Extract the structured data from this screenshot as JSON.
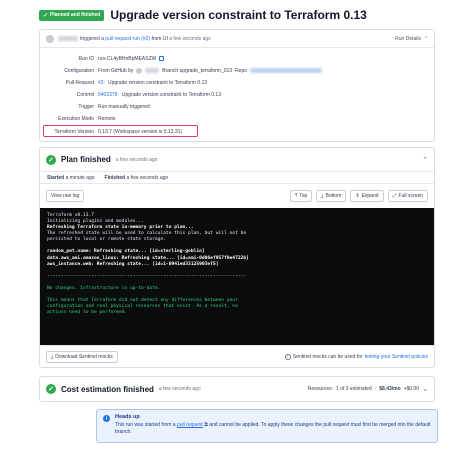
{
  "header": {
    "badge": "Planned and finished",
    "title": "Upgrade version constraint to Terraform 0.13"
  },
  "run": {
    "triggered_text": "triggered a",
    "pr_link": "pull request run (#2)",
    "from_text": "from UI",
    "ago": "a few seconds ago",
    "details_label": "Run Details",
    "fields": {
      "run_id_label": "Run ID",
      "run_id": "run-CL4yBHnBpMEASZW",
      "configuration_label": "Configuration",
      "configuration_from": "From GitHub by",
      "configuration_branch": "Branch upgrade_terraform_013",
      "configuration_repo_label": "Repo",
      "pull_request_label": "Pull Request",
      "pull_request_num": "#2:",
      "pull_request_title": "Upgrade version constraint to Terraform 0.13",
      "commit_label": "Commit",
      "commit_sha": "5402379:",
      "commit_msg": "Upgrade version constraint to Terraform 0.13",
      "trigger_label": "Trigger",
      "trigger": "Run manually triggered",
      "execution_mode_label": "Execution Mode",
      "execution_mode": "Remote",
      "tf_version_label": "Terraform Version",
      "tf_version": "0.13.7 (Workspace version is 0.12.31)"
    }
  },
  "plan": {
    "title": "Plan finished",
    "ago": "a few seconds ago",
    "started_label": "Started",
    "started": "a minute ago",
    "finished_label": "Finished",
    "finished": "a few seconds ago",
    "view_raw_log": "View raw log",
    "top": "Top",
    "bottom": "Bottom",
    "expand": "Expand",
    "full_screen": "Full screen",
    "log": {
      "l1": "Terraform v0.13.7",
      "l2": "Initializing plugins and modules...",
      "l3": "Refreshing Terraform state in-memory prior to plan...",
      "l4": "The refreshed state will be used to calculate this plan, but will not be",
      "l5": "persisted to local or remote state storage.",
      "l6": "random_pet.name: Refreshing state... [id=sterling-goblin]",
      "l7": "data.aws_ami.amazon_linux: Refreshing state... [id=ami-0d06ef957f0e4722b]",
      "l8": "aws_instance.web: Refreshing state... [id=i-0941ed33125903ef5]",
      "l9": "------------------------------------------------------------------------",
      "l10": "No changes. Infrastructure is up-to-date.",
      "l11": "This means that Terraform did not detect any differences between your",
      "l12": "configuration and real physical resources that exist. As a result, no",
      "l13": "actions need to be performed."
    },
    "download_mocks": "Download Sentinel mocks",
    "mocks_note": "Sentinel mocks can be used for",
    "mocks_link": "testing your Sentinel policies"
  },
  "cost": {
    "title": "Cost estimation finished",
    "ago": "a few seconds ago",
    "resources_label": "Resources:",
    "resources": "1 of 3 estimated",
    "separator": "·",
    "monthly": "$8.43/mo",
    "delta": "+$0.00"
  },
  "heads_up": {
    "title": "Heads up",
    "body_pre": "This run was started from a",
    "body_link": "pull request",
    "body_post": "and cannot be applied. To apply these changes the pull request must first be merged into the default branch."
  }
}
